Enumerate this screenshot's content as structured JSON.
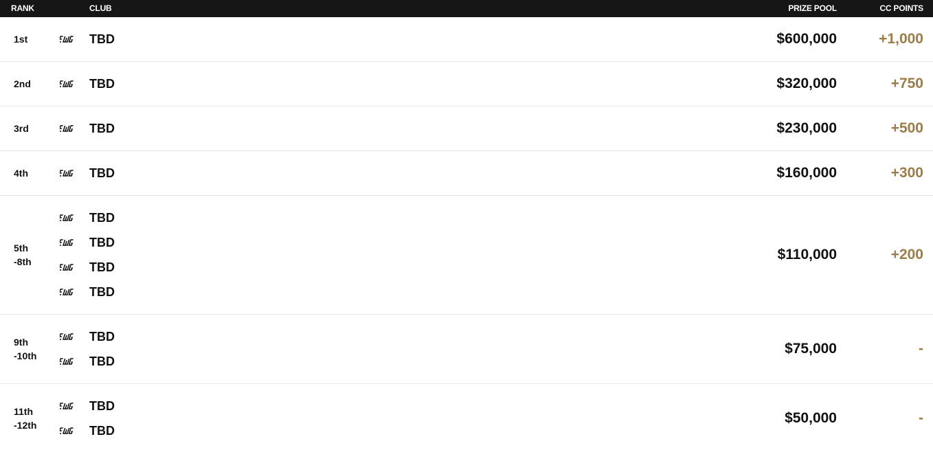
{
  "header": {
    "rank": "RANK",
    "club": "CLUB",
    "prize_pool": "PRIZE POOL",
    "cc_points": "CC POINTS"
  },
  "colors": {
    "header_bg": "#161616",
    "points_accent": "#9b7d4c",
    "divider": "#e6e6e6"
  },
  "club_logo_icon": "ewc-logo-icon",
  "rows": [
    {
      "rank_lines": [
        "1st"
      ],
      "clubs": [
        "TBD"
      ],
      "prize": "$600,000",
      "points": "+1,000"
    },
    {
      "rank_lines": [
        "2nd"
      ],
      "clubs": [
        "TBD"
      ],
      "prize": "$320,000",
      "points": "+750"
    },
    {
      "rank_lines": [
        "3rd"
      ],
      "clubs": [
        "TBD"
      ],
      "prize": "$230,000",
      "points": "+500"
    },
    {
      "rank_lines": [
        "4th"
      ],
      "clubs": [
        "TBD"
      ],
      "prize": "$160,000",
      "points": "+300"
    },
    {
      "rank_lines": [
        "5th",
        "-8th"
      ],
      "clubs": [
        "TBD",
        "TBD",
        "TBD",
        "TBD"
      ],
      "prize": "$110,000",
      "points": "+200"
    },
    {
      "rank_lines": [
        "9th",
        "-10th"
      ],
      "clubs": [
        "TBD",
        "TBD"
      ],
      "prize": "$75,000",
      "points": "-"
    },
    {
      "rank_lines": [
        "11th",
        "-12th"
      ],
      "clubs": [
        "TBD",
        "TBD"
      ],
      "prize": "$50,000",
      "points": "-"
    }
  ]
}
